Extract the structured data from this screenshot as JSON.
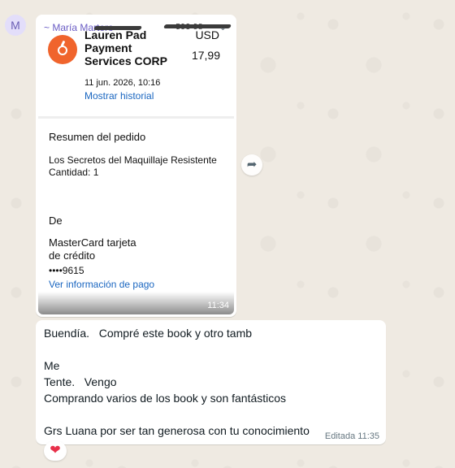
{
  "avatar": {
    "initial": "M"
  },
  "image_message": {
    "sender_name": "~ María Martero",
    "sender_phone": "+593 98",
    "time": "11:34",
    "receipt": {
      "merchant_name": "Lauren Pad\nPayment\nServices CORP",
      "currency": "USD",
      "amount": "17,99",
      "date": "11 jun. 2026, 10:16",
      "history_link": "Mostrar historial",
      "summary_title": "Resumen del pedido",
      "product": "Los Secretos del Maquillaje Resistente",
      "quantity": "Cantidad: 1",
      "from_title": "De",
      "card_name": "MasterCard tarjeta\nde crédito",
      "card_number": "••••9615",
      "payment_link": "Ver información de pago"
    }
  },
  "forward_icon": "forward-arrow",
  "text_message": {
    "lines": [
      "Buendía.   Compré este book y otro tamb",
      "",
      "Me",
      "Tente.   Vengo",
      "Comprando varios de los book y son fantásticos",
      "",
      "Grs Luana por ser tan generosa con tu conocimiento"
    ],
    "edited_label": "Editada",
    "time": "11:35"
  },
  "reaction": {
    "emoji": "❤",
    "color": "#e8304a"
  }
}
